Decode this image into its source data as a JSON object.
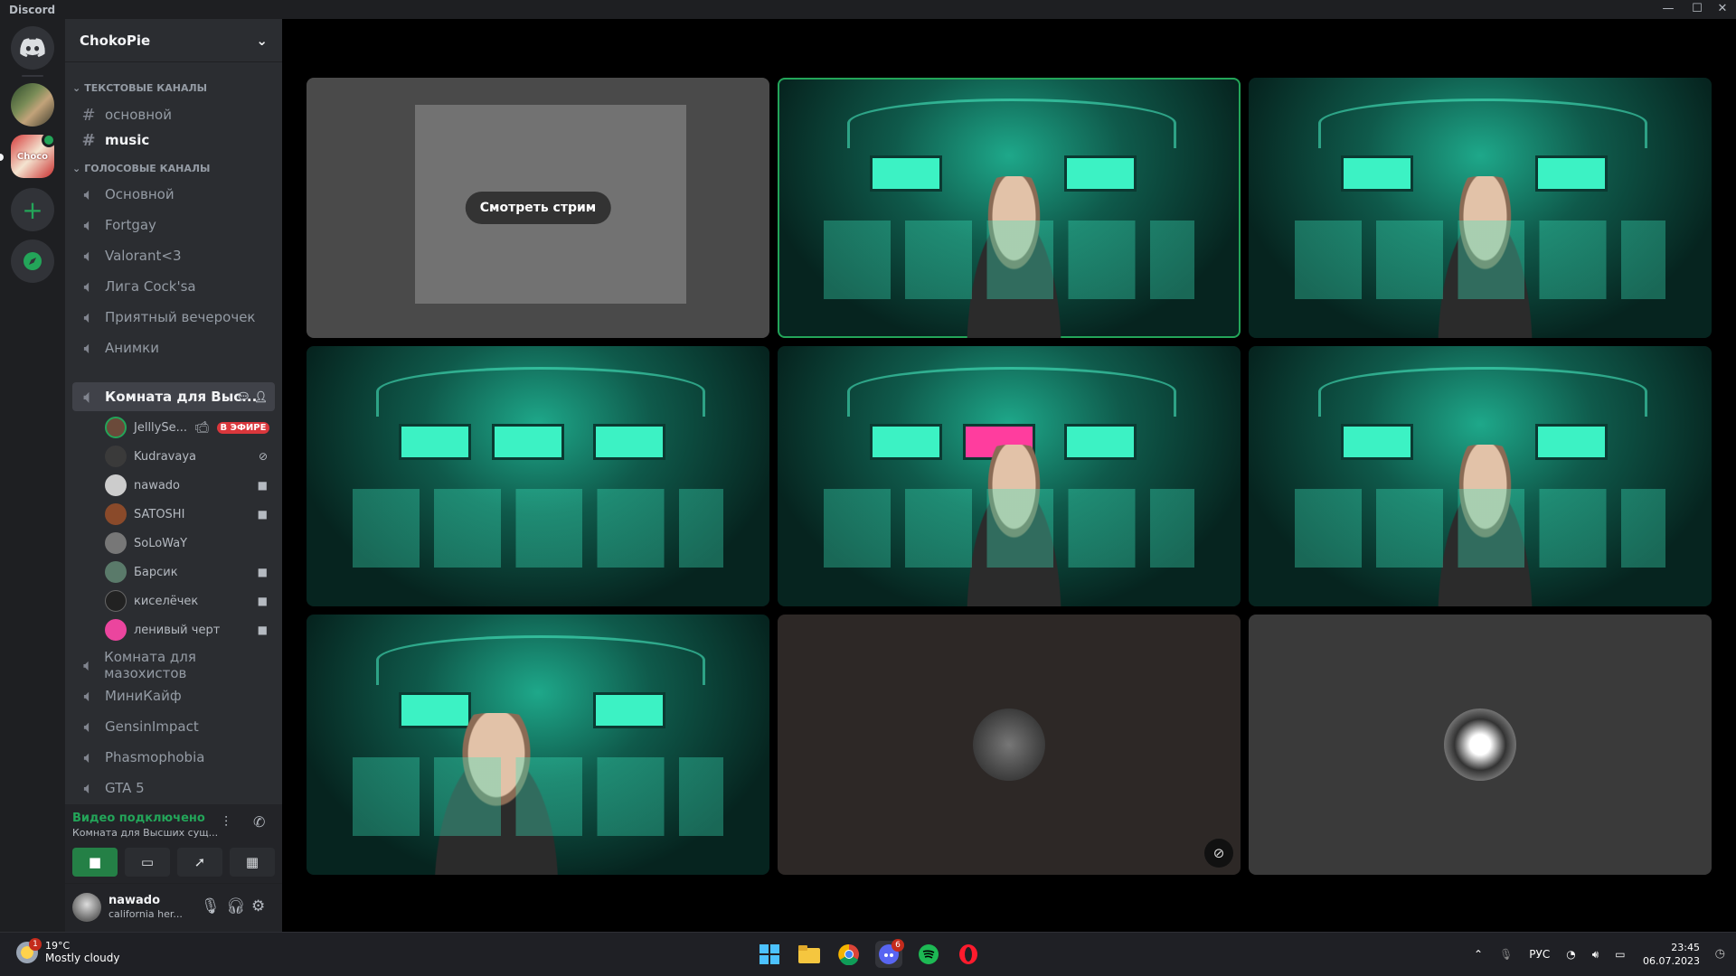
{
  "app": {
    "title": "Discord",
    "win_min": "—",
    "win_max": "☐",
    "win_close": "✕"
  },
  "server": {
    "name": "ChokoPie",
    "badge": "Choco"
  },
  "categories": {
    "text": "ТЕКСТОВЫЕ КАНАЛЫ",
    "voice": "ГОЛОСОВЫЕ КАНАЛЫ"
  },
  "text_channels": [
    "основной",
    "music"
  ],
  "voice_channels": [
    "Основной",
    "Fortgay",
    "Valorant<3",
    "Лига Cock'sa",
    "Приятный вечерочек",
    "Анимки",
    "Комната для Выс..."
  ],
  "voice_users": [
    {
      "name": "JelllySe...",
      "live": "В ЭФИРЕ"
    },
    {
      "name": "Kudravaya"
    },
    {
      "name": "nawado"
    },
    {
      "name": "SATOSHI"
    },
    {
      "name": "SoLoWaY"
    },
    {
      "name": "Барсик"
    },
    {
      "name": "киселёчек"
    },
    {
      "name": "ленивый черт"
    }
  ],
  "more_channels": [
    "Комната для мазохистов",
    "МиниКайф",
    "GensinImpact",
    "Phasmophobia",
    "GTA 5"
  ],
  "rtc": {
    "status": "Видео подключено",
    "room": "Комната для Высших сущ..."
  },
  "user": {
    "name": "nawado",
    "status": "california her..."
  },
  "stream": {
    "watch_label": "Смотреть стрим"
  },
  "taskbar": {
    "temp": "19°C",
    "weather": "Mostly cloudy",
    "weather_badge": "1",
    "lang": "РУС",
    "time": "23:45",
    "date": "06.07.2023",
    "discord_badge": "6"
  },
  "colors": {
    "accent_green": "#23a559",
    "live_red": "#da373c",
    "sidebar": "#2b2d31"
  }
}
